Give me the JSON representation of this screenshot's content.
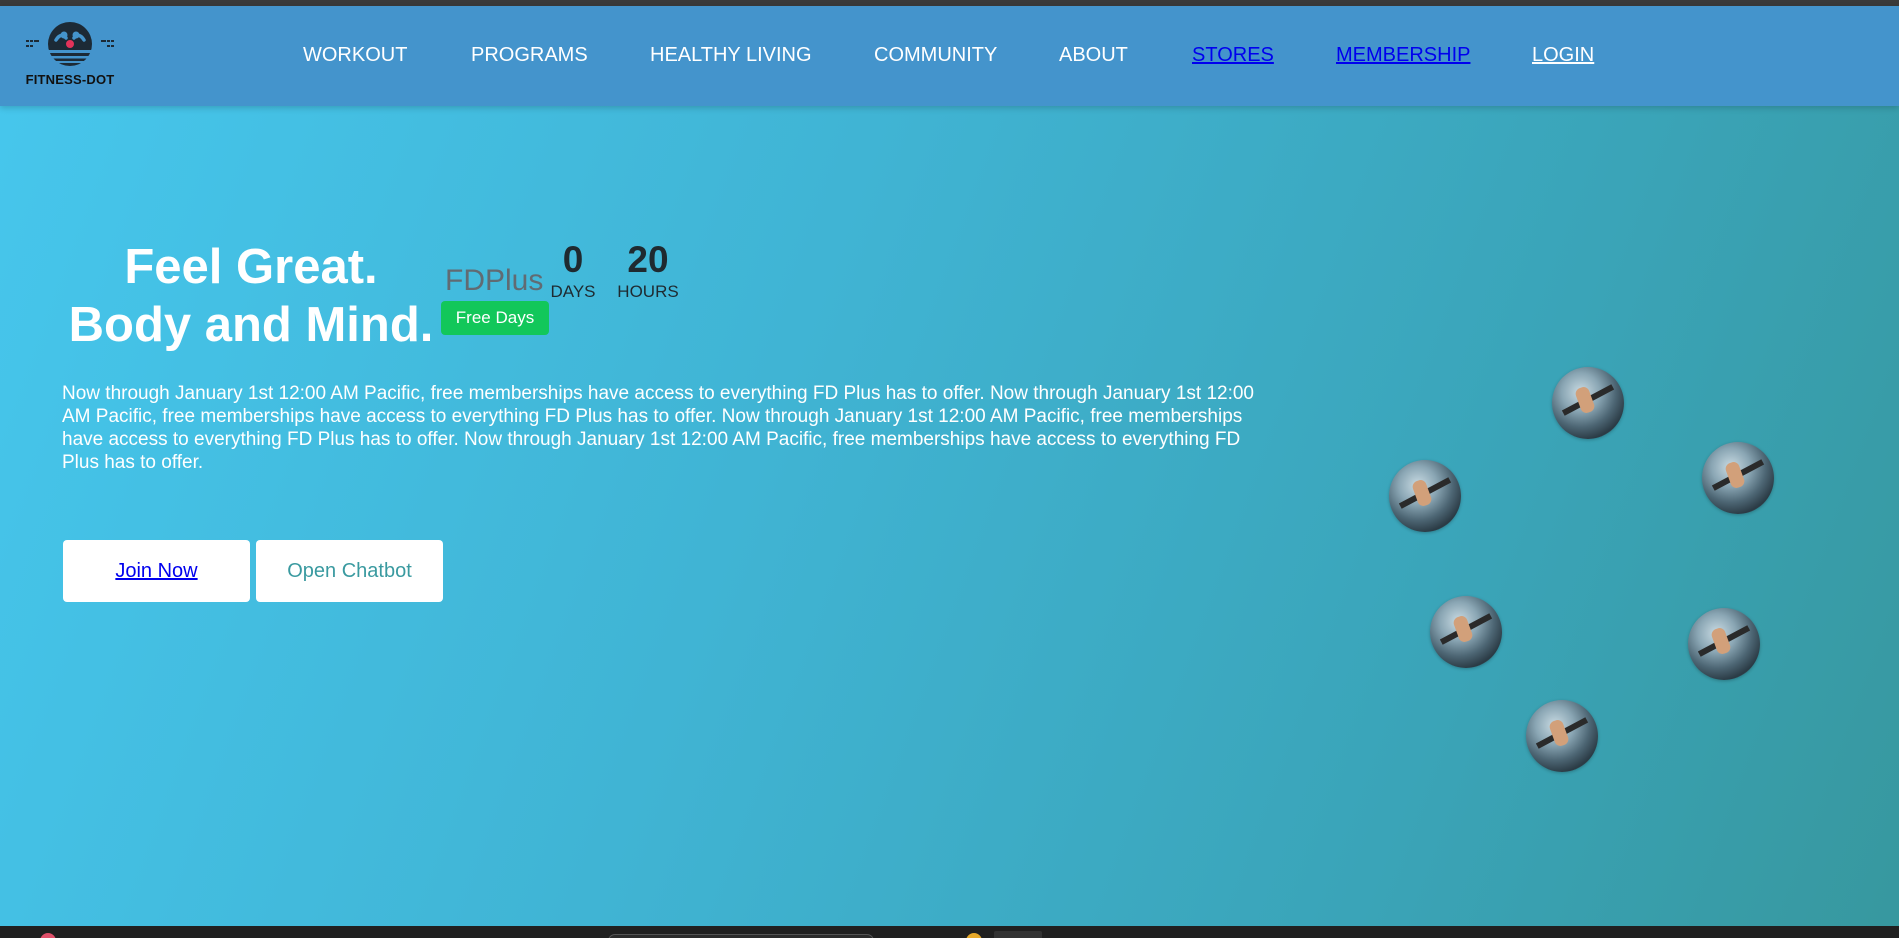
{
  "brand": {
    "logo_text": "FITNESS-DOT"
  },
  "nav": {
    "items": [
      {
        "label": "WORKOUT"
      },
      {
        "label": "PROGRAMS"
      },
      {
        "label": "HEALTHY LIVING"
      },
      {
        "label": "COMMUNITY"
      },
      {
        "label": "ABOUT"
      },
      {
        "label": "STORES"
      },
      {
        "label": "MEMBERSHIP"
      },
      {
        "label": "LOGIN"
      }
    ]
  },
  "hero": {
    "headline_line1": "Feel Great.",
    "headline_line2": "Body and Mind.",
    "promo_text": "Now through January 1st 12:00 AM Pacific, free memberships have access to everything FD Plus has to offer. Now through January 1st 12:00 AM Pacific, free memberships have access to everything FD Plus has to offer. Now through January 1st 12:00 AM Pacific, free memberships have access to everything FD Plus has to offer. Now through January 1st 12:00 AM Pacific, free memberships have access to everything FD Plus has to offer.",
    "join_button": "Join Now",
    "chatbot_button": "Open Chatbot"
  },
  "promo": {
    "fdplus_label": "FDPlus",
    "badge": "Free Days",
    "countdown": {
      "days_value": "0",
      "days_label": "DAYS",
      "hours_value": "20",
      "hours_label": "HOURS"
    }
  },
  "colors": {
    "nav_background": "#4494cc",
    "hero_gradient_start": "#46c6ec",
    "hero_gradient_end": "#37989f",
    "badge_green": "#12c75a",
    "link_blue": "#0000ee"
  },
  "icons": {
    "logo": "fitness-dot-logo-icon",
    "gallery": "gym-photo-bubble"
  }
}
